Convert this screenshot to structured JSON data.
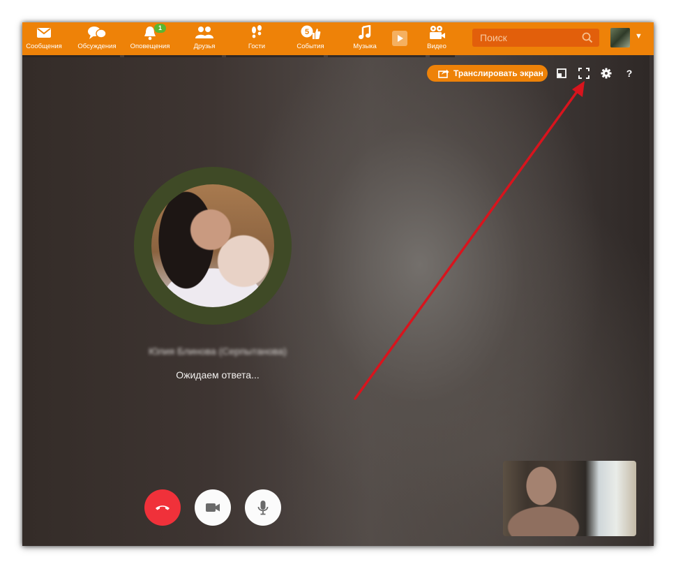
{
  "nav": {
    "items": [
      {
        "label": "Сообщения",
        "icon": "envelope-icon"
      },
      {
        "label": "Обсуждения",
        "icon": "chat-bubbles-icon"
      },
      {
        "label": "Оповещения",
        "icon": "bell-icon",
        "badge": "1"
      },
      {
        "label": "Друзья",
        "icon": "friends-icon"
      },
      {
        "label": "Гости",
        "icon": "footprints-icon"
      },
      {
        "label": "События",
        "icon": "like-events-icon",
        "badge": "5"
      },
      {
        "label": "Музыка",
        "icon": "music-note-icon"
      },
      {
        "label": "",
        "icon": "video-play-tile-icon"
      },
      {
        "label": "Видео",
        "icon": "film-camera-icon"
      }
    ]
  },
  "search": {
    "placeholder": "Поиск"
  },
  "call": {
    "share_screen_label": "Транслировать экран",
    "help_symbol": "?",
    "contact_name": "Юлия Блинова (Серпытанова)",
    "status": "Ожидаем ответа..."
  },
  "colors": {
    "brand_orange": "#ee8208",
    "search_bg": "#e25f0b",
    "badge_green": "#5ab531",
    "hangup_red": "#f0313a",
    "annotation_arrow": "#d8141d"
  }
}
